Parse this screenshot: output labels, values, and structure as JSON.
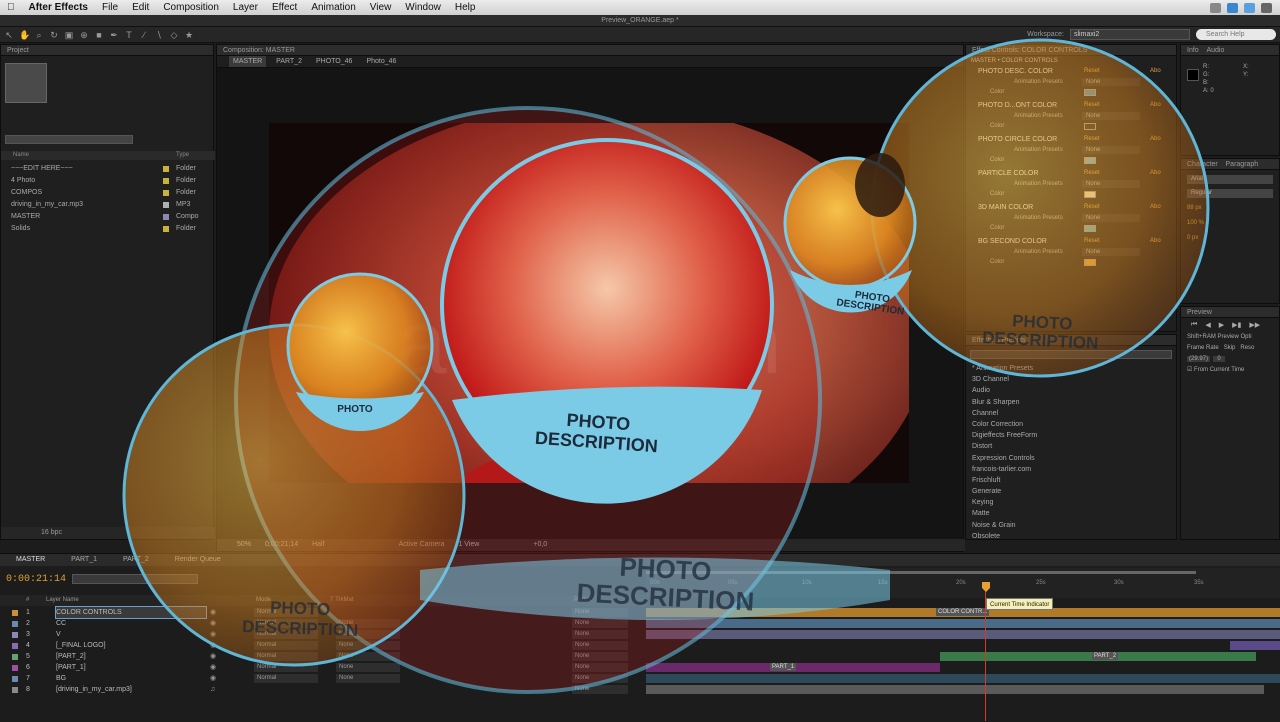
{
  "menubar": {
    "app": "After Effects",
    "items": [
      "File",
      "Edit",
      "Composition",
      "Layer",
      "Effect",
      "Animation",
      "View",
      "Window",
      "Help"
    ]
  },
  "window_title": "Preview_ORANGE.aep *",
  "toolbar": {
    "workspace_label": "Workspace:",
    "workspace_value": "slimaxi2",
    "search_placeholder": "Search Help"
  },
  "project": {
    "tab": "Project",
    "columns": [
      "Name",
      "Type"
    ],
    "rows": [
      {
        "name": "~~~EDIT HERE~~~",
        "type": "Folder"
      },
      {
        "name": "4 Photo",
        "type": "Folder"
      },
      {
        "name": "COMPOS",
        "type": "Folder"
      },
      {
        "name": "driving_in_my_car.mp3",
        "type": "MP3"
      },
      {
        "name": "MASTER",
        "type": "Compo"
      },
      {
        "name": "Solids",
        "type": "Folder"
      }
    ],
    "bpc": "16 bpc"
  },
  "composition": {
    "tab": "Composition: MASTER",
    "breadcrumbs": [
      "MASTER",
      "PART_2",
      "PHOTO_46",
      "Photo_46"
    ],
    "footer": {
      "zoom": "50%",
      "timecode": "0;00;21;14",
      "res": "Half",
      "camera": "Active Camera",
      "view": "1 View",
      "offset": "+0,0"
    },
    "watermark": "activeden"
  },
  "effect_controls": {
    "tab": "Effect Controls: COLOR CONTROLS",
    "header": "MASTER • COLOR CONTROLS",
    "groups": [
      {
        "name": "PHOTO DESC. COLOR"
      },
      {
        "name": "PHOTO D...ONT COLOR"
      },
      {
        "name": "PHOTO CIRCLE COLOR"
      },
      {
        "name": "PARTICLE COLOR"
      },
      {
        "name": "3D MAIN COLOR"
      },
      {
        "name": "BG SECOND COLOR"
      }
    ],
    "reset": "Reset",
    "about": "Abo",
    "anim_presets": "Animation Presets",
    "none": "None",
    "color": "Color"
  },
  "presets": {
    "tab": "Effects & Presets",
    "items": [
      "* Animation Presets",
      "3D Channel",
      "Audio",
      "Blur & Sharpen",
      "Channel",
      "Color Correction",
      "Digieffects FreeForm",
      "Distort",
      "Expression Controls",
      "francois-tarlier.com",
      "Frischluft",
      "Generate",
      "Keying",
      "Matte",
      "Noise & Grain",
      "Obsolete"
    ]
  },
  "info": {
    "tabs": [
      "Info",
      "Audio"
    ],
    "rgb": [
      "R:",
      "G:",
      "B:",
      "A: 0"
    ],
    "xy": [
      "X:",
      "Y:"
    ]
  },
  "character": {
    "tabs": [
      "Character",
      "Paragraph"
    ],
    "font": "Arial",
    "style": "Regular",
    "size": "88 px",
    "tracking": "100 %",
    "baseline": "0 px"
  },
  "preview": {
    "tab": "Preview",
    "ram": "Shift+RAM Preview Opti",
    "frame_rate_label": "Frame Rate",
    "skip_label": "Skip",
    "res_label": "Reso",
    "frame_rate": "(29.97)",
    "skip": "0",
    "from_current": "From Current Time"
  },
  "timeline": {
    "tabs": [
      "MASTER",
      "PART_1",
      "PART_2",
      "Render Queue"
    ],
    "timecode": "0:00:21:14",
    "ruler": [
      "00s",
      "05s",
      "10s",
      "15s",
      "20s",
      "25s",
      "30s",
      "35s"
    ],
    "tooltip": "Current Time Indicator",
    "columns": [
      "#",
      "Layer Name",
      "Mode",
      "T TrkMat",
      "Parent"
    ],
    "layers": [
      {
        "num": "1",
        "name": "COLOR CONTROLS",
        "mode": "Normal",
        "trk": "",
        "parent": "None",
        "label_color": "#c8903a",
        "bar_label": "COLOR CONTR..."
      },
      {
        "num": "2",
        "name": "CC",
        "mode": "Normal",
        "trk": "None",
        "parent": "None",
        "label_color": "#6a8ab0",
        "bar_label": ""
      },
      {
        "num": "3",
        "name": "V",
        "mode": "Normal",
        "trk": "None",
        "parent": "None",
        "label_color": "#8a8ab0",
        "bar_label": ""
      },
      {
        "num": "4",
        "name": "[_FINAL LOGO]",
        "mode": "Normal",
        "trk": "None",
        "parent": "None",
        "label_color": "#8a6ab0",
        "bar_label": ""
      },
      {
        "num": "5",
        "name": "[PART_2]",
        "mode": "Normal",
        "trk": "None",
        "parent": "None",
        "label_color": "#6aa070",
        "bar_label": "PART_2"
      },
      {
        "num": "6",
        "name": "[PART_1]",
        "mode": "Normal",
        "trk": "None",
        "parent": "None",
        "label_color": "#a050a0",
        "bar_label": "PART_1"
      },
      {
        "num": "7",
        "name": "BG",
        "mode": "Normal",
        "trk": "None",
        "parent": "None",
        "label_color": "#6a8ab0",
        "bar_label": ""
      },
      {
        "num": "8",
        "name": "[driving_in_my_car.mp3]",
        "mode": "",
        "trk": "",
        "parent": "None",
        "label_color": "#8a8a8a",
        "bar_label": ""
      }
    ]
  },
  "bubbles": {
    "caption_top": "PHOTO",
    "caption_bottom": "DESCRIPTION"
  },
  "colors": {
    "bubble_ring": "#5fb6d6",
    "bubble_band": "#7ccbe6",
    "accent": "#e0a030",
    "cti": "#d23a2a"
  }
}
